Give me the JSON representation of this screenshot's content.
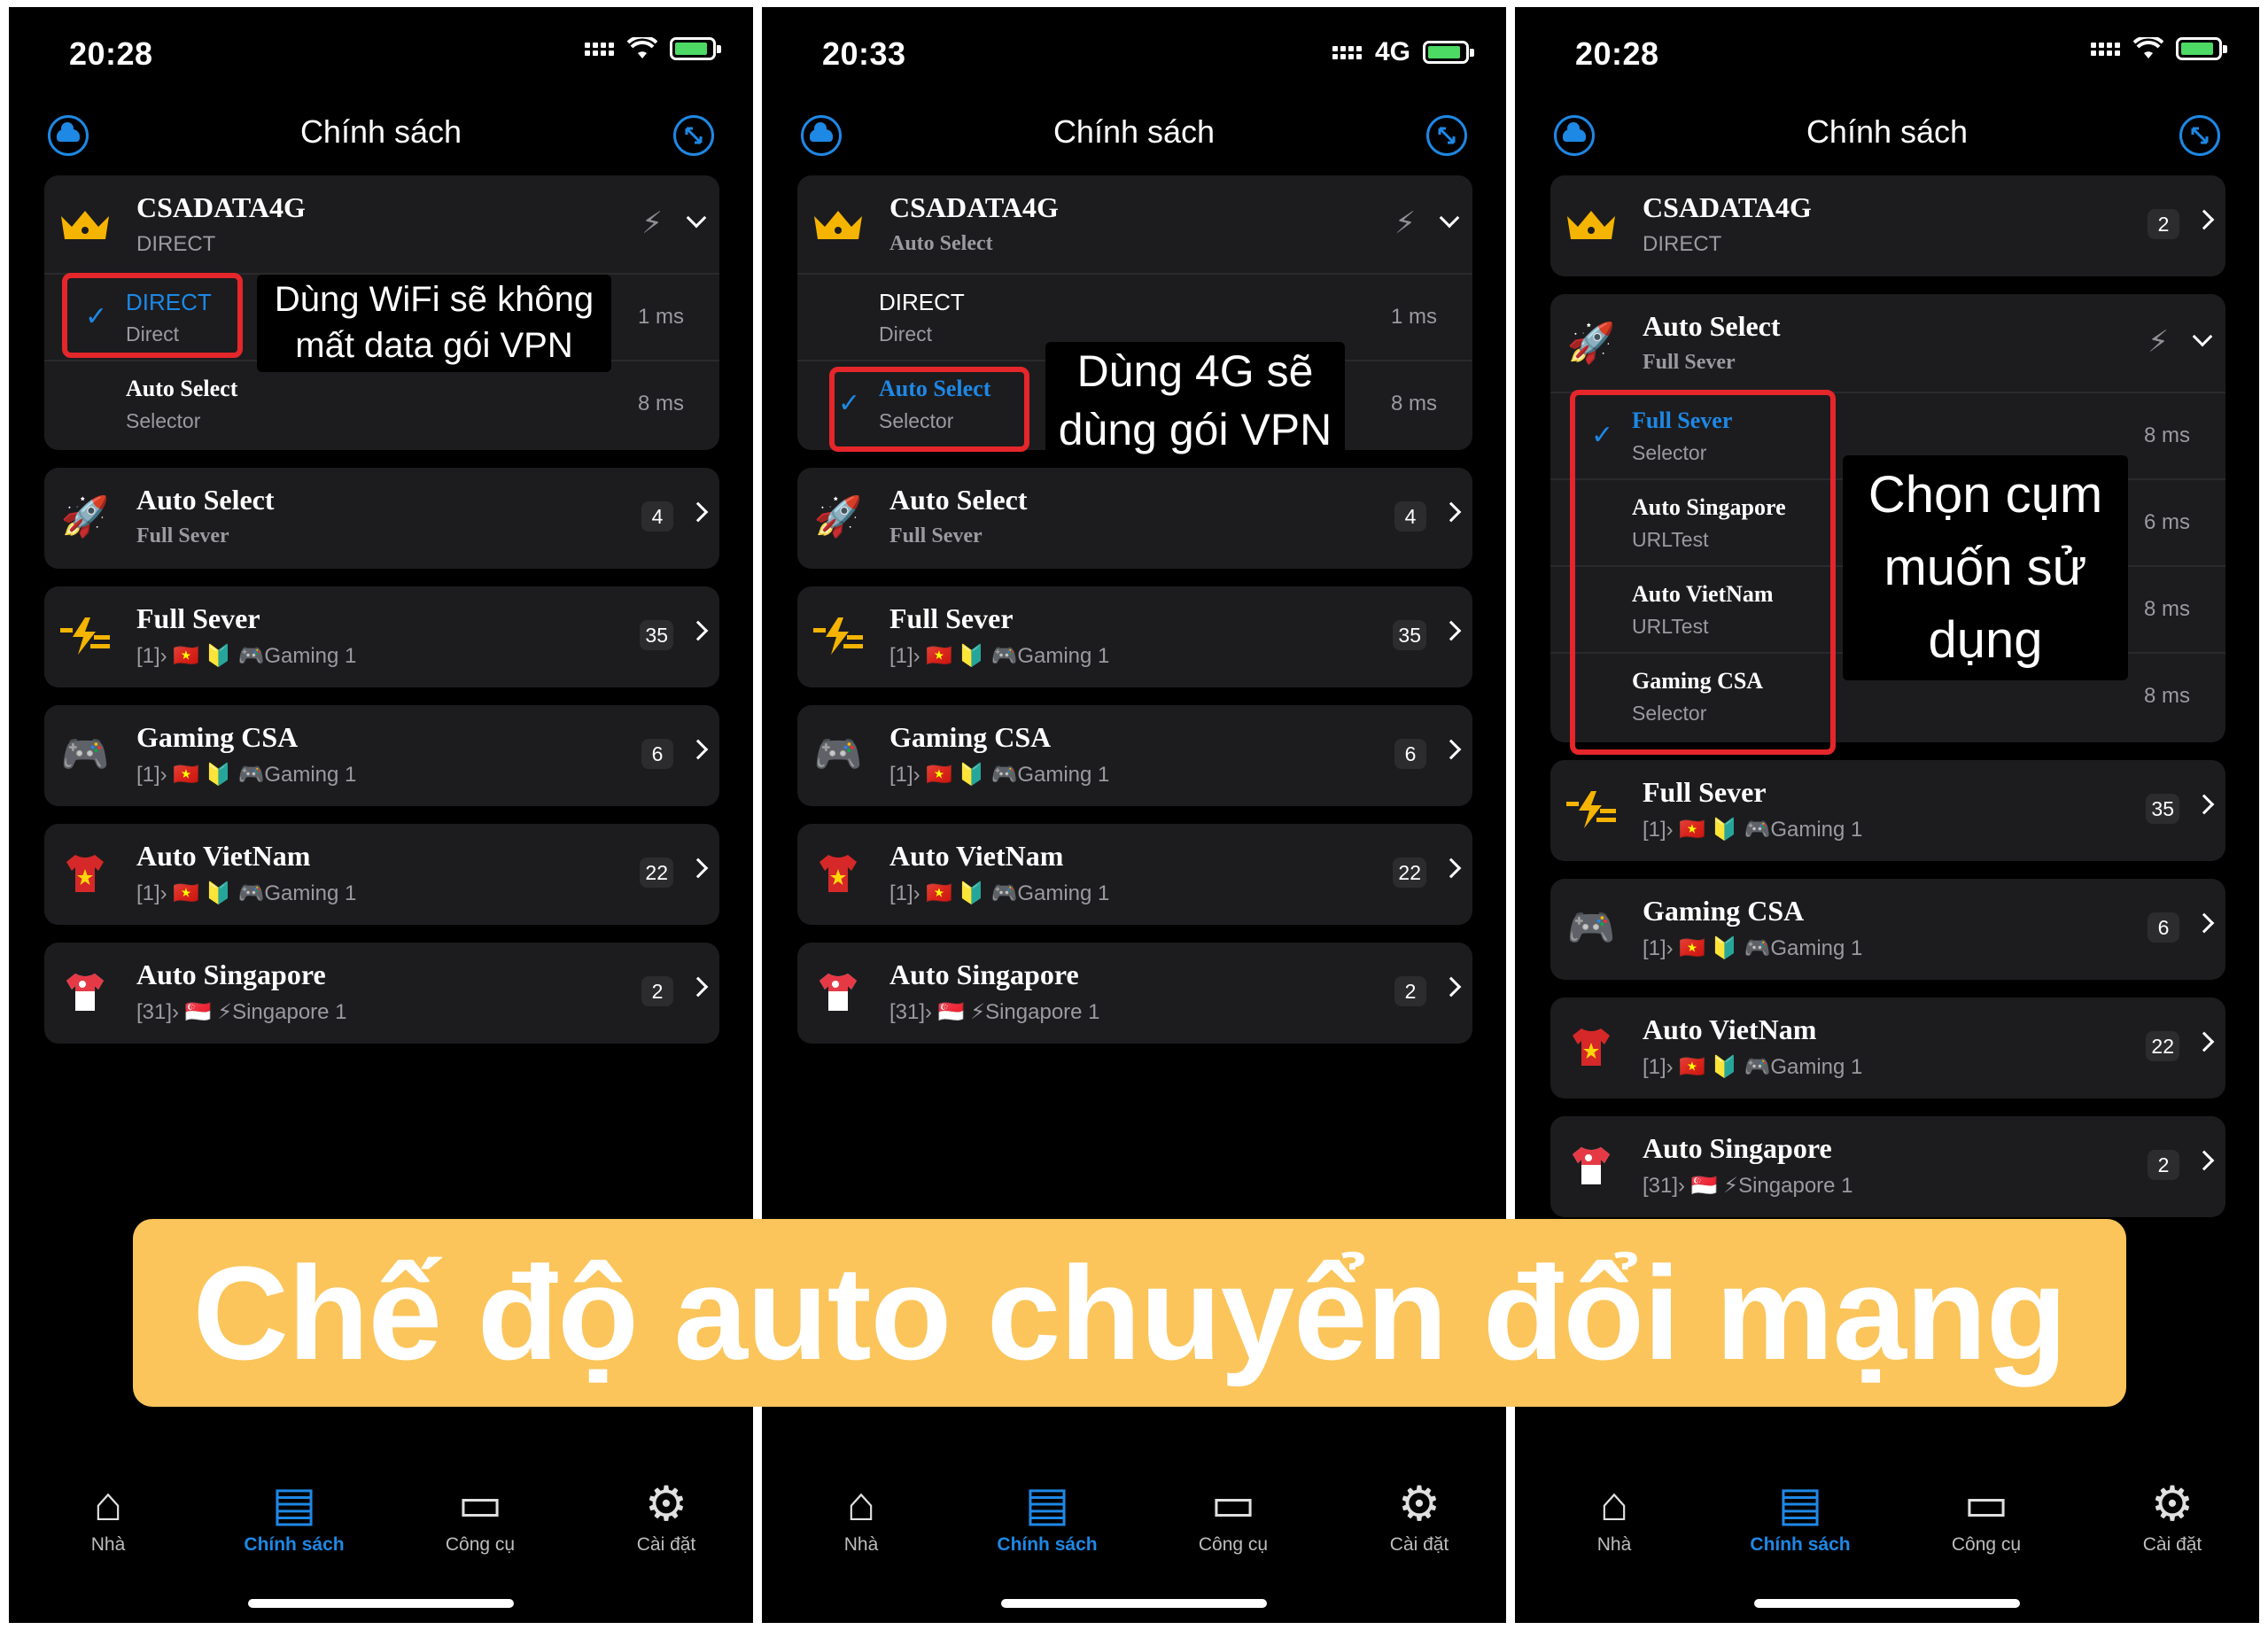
{
  "screens": [
    {
      "time": "20:28",
      "network": "wifi",
      "title": "Chính sách",
      "expanded": {
        "name": "CSADATA4G",
        "sub": "DIRECT",
        "rows": [
          {
            "name": "DIRECT",
            "sub": "Direct",
            "ms": "1 ms",
            "selected": true
          },
          {
            "name": "Auto Select",
            "sub": "Selector",
            "ms": "8 ms",
            "selected": false
          }
        ]
      },
      "callout": "Dùng WiFi sẽ không mất data gói VPN",
      "cards": [
        {
          "name": "Auto Select",
          "sub": "Full Sever",
          "count": "4",
          "icon": "rocket-icon"
        },
        {
          "name": "Full Sever",
          "sub": "[1]› 🇻🇳 🔰 🎮Gaming 1",
          "count": "35",
          "icon": "bolt-lines-icon"
        },
        {
          "name": "Gaming CSA",
          "sub": "[1]› 🇻🇳 🔰 🎮Gaming 1",
          "count": "6",
          "icon": "gamepad-icon"
        },
        {
          "name": "Auto VietNam",
          "sub": "[1]› 🇻🇳 🔰 🎮Gaming 1",
          "count": "22",
          "icon": "vn-shirt-icon"
        },
        {
          "name": "Auto Singapore",
          "sub": "[31]› 🇸🇬 ⚡Singapore 1",
          "count": "2",
          "icon": "sg-shirt-icon"
        }
      ]
    },
    {
      "time": "20:33",
      "network": "4G",
      "title": "Chính sách",
      "expanded": {
        "name": "CSADATA4G",
        "sub": "Auto Select",
        "rows": [
          {
            "name": "DIRECT",
            "sub": "Direct",
            "ms": "1 ms",
            "selected": false
          },
          {
            "name": "Auto Select",
            "sub": "Selector",
            "ms": "8 ms",
            "selected": true
          }
        ]
      },
      "callout": "Dùng 4G sẽ dùng gói VPN",
      "cards": [
        {
          "name": "Auto Select",
          "sub": "Full Sever",
          "count": "4"
        },
        {
          "name": "Full Sever",
          "sub": "[1]› 🇻🇳 🔰 🎮Gaming 1",
          "count": "35"
        },
        {
          "name": "Gaming CSA",
          "sub": "[1]› 🇻🇳 🔰 🎮Gaming 1",
          "count": "6"
        },
        {
          "name": "Auto VietNam",
          "sub": "[1]› 🇻🇳 🔰 🎮Gaming 1",
          "count": "22"
        },
        {
          "name": "Auto Singapore",
          "sub": "[31]› 🇸🇬 ⚡Singapore 1",
          "count": "2"
        }
      ]
    },
    {
      "time": "20:28",
      "network": "wifi",
      "title": "Chính sách",
      "top_card": {
        "name": "CSADATA4G",
        "sub": "DIRECT",
        "count": "2"
      },
      "expanded": {
        "name": "Auto Select",
        "sub": "Full Sever",
        "rows": [
          {
            "name": "Full Sever",
            "sub": "Selector",
            "ms": "8 ms",
            "selected": true
          },
          {
            "name": "Auto Singapore",
            "sub": "URLTest",
            "ms": "6 ms",
            "selected": false
          },
          {
            "name": "Auto VietNam",
            "sub": "URLTest",
            "ms": "8 ms",
            "selected": false
          },
          {
            "name": "Gaming CSA",
            "sub": "Selector",
            "ms": "8 ms",
            "selected": false
          }
        ]
      },
      "callout": "Chọn cụm muốn sử dụng",
      "cards": [
        {
          "name": "Full Sever",
          "sub": "[1]› 🇻🇳 🔰 🎮Gaming 1",
          "count": "35"
        },
        {
          "name": "Gaming CSA",
          "sub": "[1]› 🇻🇳 🔰 🎮Gaming 1",
          "count": "6"
        },
        {
          "name": "Auto VietNam",
          "sub": "[1]› 🇻🇳 🔰 🎮Gaming 1",
          "count": "22"
        },
        {
          "name": "Auto Singapore",
          "sub": "[31]› 🇸🇬 ⚡Singapore 1",
          "count": "2"
        }
      ]
    }
  ],
  "tabs": [
    "Nhà",
    "Chính sách",
    "Công cụ",
    "Cài đặt"
  ],
  "banner": "Chế độ auto chuyển đổi mạng",
  "colors": {
    "accent": "#1e88e5",
    "highlight": "#e5262a",
    "banner": "#fbc55b",
    "card": "#1c1c1e"
  }
}
